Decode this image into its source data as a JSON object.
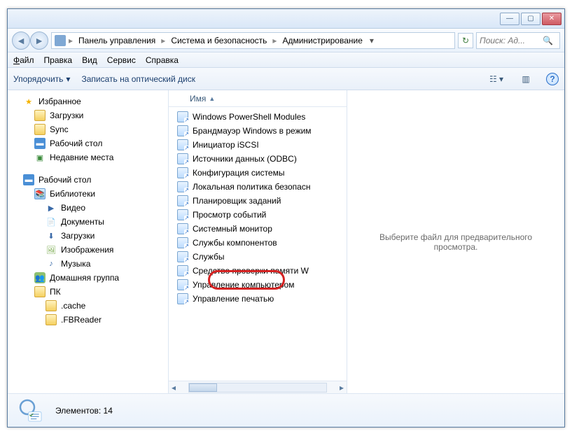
{
  "titlebar": {
    "min": "—",
    "max": "▢",
    "close": "✕"
  },
  "breadcrumb": {
    "items": [
      "Панель управления",
      "Система и безопасность",
      "Администрирование"
    ]
  },
  "search": {
    "placeholder": "Поиск: Ад..."
  },
  "menu": {
    "file": "Файл",
    "edit": "Правка",
    "view": "Вид",
    "tools": "Сервис",
    "help": "Справка"
  },
  "toolbar": {
    "organize": "Упорядочить",
    "burn": "Записать на оптический диск"
  },
  "sidebar": {
    "favorites": "Избранное",
    "downloads": "Загрузки",
    "sync": "Sync",
    "desktop": "Рабочий стол",
    "recent": "Недавние места",
    "desktop2": "Рабочий стол",
    "libraries": "Библиотеки",
    "video": "Видео",
    "documents": "Документы",
    "downloads2": "Загрузки",
    "pictures": "Изображения",
    "music": "Музыка",
    "homegroup": "Домашняя группа",
    "pc": "ПК",
    "cache": ".cache",
    "fbreader": ".FBReader"
  },
  "columns": {
    "name": "Имя"
  },
  "files": [
    "Windows PowerShell Modules",
    "Брандмауэр Windows в режим",
    "Инициатор iSCSI",
    "Источники данных (ODBC)",
    "Конфигурация системы",
    "Локальная политика безопасн",
    "Планировщик заданий",
    "Просмотр событий",
    "Системный монитор",
    "Службы компонентов",
    "Службы",
    "Средство проверки памяти W",
    "Управление компьютером",
    "Управление печатью"
  ],
  "preview": {
    "empty": "Выберите файл для предварительного просмотра."
  },
  "status": {
    "count_label": "Элементов:",
    "count": "14"
  }
}
